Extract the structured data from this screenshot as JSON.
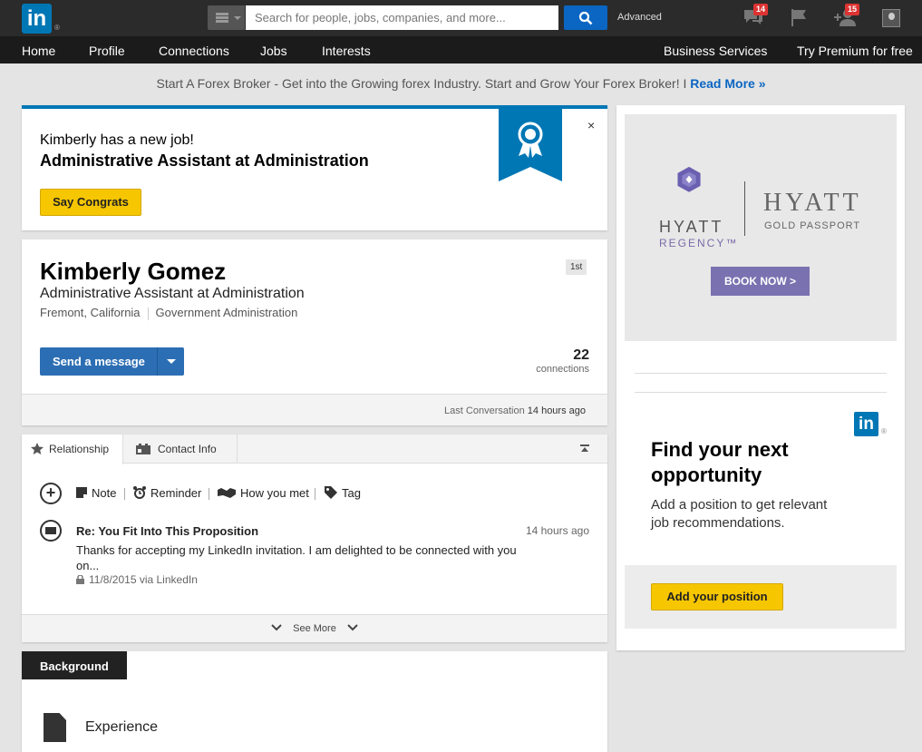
{
  "topbar": {
    "logo": "in",
    "search_placeholder": "Search for people, jobs, companies, and more...",
    "advanced_label": "Advanced",
    "messages_count": "14",
    "invites_count": "15"
  },
  "nav": {
    "items": [
      "Home",
      "Profile",
      "Connections",
      "Jobs",
      "Interests"
    ],
    "business": "Business Services",
    "premium": "Try Premium for free"
  },
  "promo": {
    "text": "Start A Forex Broker - Get into the Growing forex Industry. Start and Grow Your Forex Broker! I ",
    "link": "Read More »"
  },
  "notice": {
    "line1": "Kimberly has a new job!",
    "line2": "Administrative Assistant at Administration",
    "button": "Say Congrats",
    "close": "×"
  },
  "profile": {
    "name": "Kimberly Gomez",
    "headline": "Administrative Assistant at Administration",
    "location": "Fremont, California",
    "industry": "Government Administration",
    "degree": "1st",
    "message_button": "Send a message",
    "connections_count": "22",
    "connections_label": "connections",
    "last_conversation_label": "Last Conversation",
    "last_conversation_time": "14 hours ago"
  },
  "relationship": {
    "tabs": [
      "Relationship",
      "Contact Info"
    ],
    "actions": [
      "Note",
      "Reminder",
      "How you met",
      "Tag"
    ],
    "message": {
      "subject": "Re: You Fit Into This Proposition",
      "time": "14 hours ago",
      "body": "Thanks for accepting my LinkedIn invitation. I am delighted to be connected with you on...",
      "date": "11/8/2015 via LinkedIn"
    },
    "see_more": "See More"
  },
  "background": {
    "tab": "Background",
    "section": "Experience"
  },
  "sidebar": {
    "ad": {
      "brand_left": "HYATT",
      "brand_left_sub": "REGENCY™",
      "brand_right": "HYATT",
      "brand_right_sub": "GOLD PASSPORT",
      "cta": "BOOK NOW >"
    },
    "job": {
      "title": "Find your next opportunity",
      "desc": "Add a position to get relevant job recommendations.",
      "button": "Add your position"
    }
  },
  "colors": {
    "linkedin_blue": "#0077b5",
    "accent_yellow": "#f6c600",
    "hyatt_purple": "#7a72b0"
  }
}
